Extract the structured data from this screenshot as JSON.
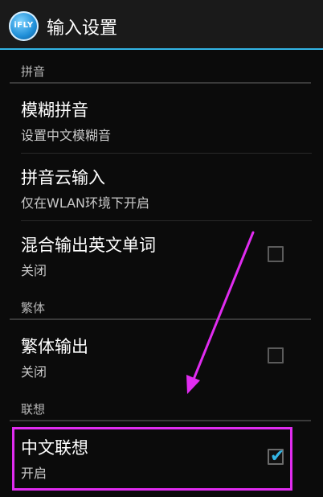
{
  "app": {
    "title": "输入设置",
    "icon_label": "iFLY",
    "icon": "ifly-logo-icon"
  },
  "sections": {
    "pinyin": {
      "title": "拼音"
    },
    "traditional": {
      "title": "繁体"
    },
    "association": {
      "title": "联想"
    }
  },
  "prefs": {
    "fuzzy": {
      "title": "模糊拼音",
      "summary": "设置中文模糊音"
    },
    "cloud": {
      "title": "拼音云输入",
      "summary": "仅在WLAN环境下开启"
    },
    "mixed": {
      "title": "混合输出英文单词",
      "summary": "关闭",
      "checked": false
    },
    "trad_output": {
      "title": "繁体输出",
      "summary": "关闭",
      "checked": false
    },
    "chinese_assoc": {
      "title": "中文联想",
      "summary": "开启",
      "checked": true
    }
  },
  "colors": {
    "accent": "#33b5e5",
    "annotation": "#e02cf0",
    "background": "#0b0b0b"
  }
}
